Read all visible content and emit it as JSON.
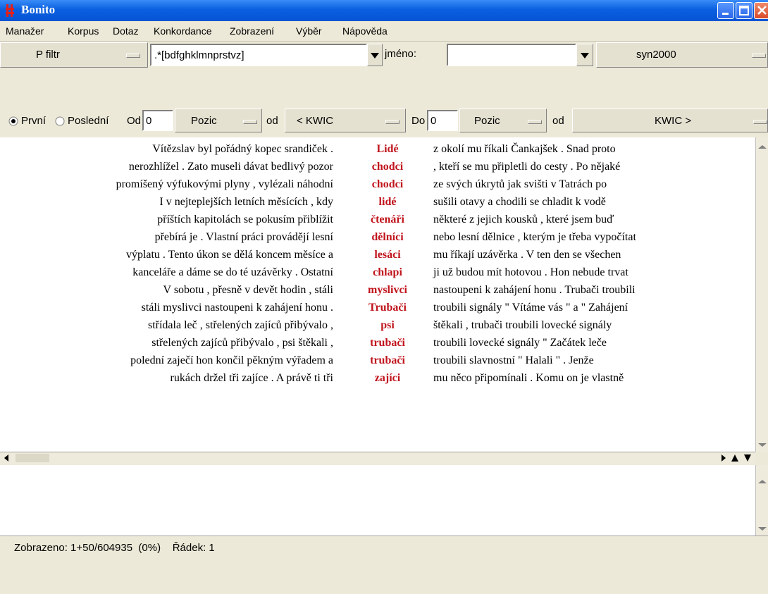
{
  "window": {
    "title": "Bonito"
  },
  "menu": [
    "Manažer",
    "Korpus",
    "Dotaz",
    "Konkordance",
    "Zobrazení",
    "Výběr",
    "Nápověda"
  ],
  "toolbar1": {
    "filter_button": "P filtr",
    "pattern_value": ".*[bdfghklmnprstvz]",
    "name_label": "jméno:",
    "name_value": "",
    "corpus_button": "syn2000"
  },
  "toolbar2": {
    "radio_first": "První",
    "radio_last": "Poslední",
    "radio_selected": "První",
    "od_label": "Od",
    "od_value": "0",
    "pozic1": "Pozic",
    "od2_label": "od",
    "kwic_left": "< KWIC",
    "do_label": "Do",
    "do_value": "0",
    "pozic2": "Pozic",
    "od3_label": "od",
    "kwic_right": "KWIC >"
  },
  "concordance": [
    {
      "left": "Vítězslav byl pořádný kopec srandiček .",
      "kwic": "Lidé",
      "right": "z okolí mu říkali Čankajšek . Snad proto"
    },
    {
      "left": "nerozhlížel . Zato museli dávat bedlivý pozor",
      "kwic": "chodci",
      "right": ", kteří se mu připletli do cesty . Po nějaké"
    },
    {
      "left": "promíšený výfukovými plyny , vylézali náhodní",
      "kwic": "chodci",
      "right": "ze svých úkrytů jak svišti v Tatrách po"
    },
    {
      "left": "I v nejteplejších letních měsících , kdy",
      "kwic": "lidé",
      "right": "sušili otavy a chodili se chladit k vodě"
    },
    {
      "left": "příštích kapitolách se pokusím přiblížit",
      "kwic": "čtenáři",
      "right": "některé z jejich kousků , které jsem buď"
    },
    {
      "left": "přebírá je . Vlastní práci provádějí lesní",
      "kwic": "dělníci",
      "right": "nebo lesní dělnice , kterým je třeba vypočítat"
    },
    {
      "left": "výplatu . Tento úkon se dělá koncem měsíce a",
      "kwic": "lesáci",
      "right": "mu říkají uzávěrka . V ten den se všechen"
    },
    {
      "left": "kanceláře a dáme se do té uzávěrky . Ostatní",
      "kwic": "chlapi",
      "right": "ji už budou mít hotovou . Hon nebude trvat"
    },
    {
      "left": "V sobotu , přesně v devět hodin , stáli",
      "kwic": "myslivci",
      "right": "nastoupeni k zahájení honu . Trubači troubili"
    },
    {
      "left": "stáli myslivci nastoupeni k zahájení honu .",
      "kwic": "Trubači",
      "right": "troubili signály \" Vítáme vás \" a \" Zahájení"
    },
    {
      "left": "střídala leč , střelených zajíců přibývalo ,",
      "kwic": "psi",
      "right": "štěkali , trubači troubili lovecké signály"
    },
    {
      "left": "střelených zajíců přibývalo , psi štěkali ,",
      "kwic": "trubači",
      "right": "troubili lovecké signály \" Začátek leče"
    },
    {
      "left": "polední zaječí hon končil pěkným výřadem a",
      "kwic": "trubači",
      "right": "troubili slavnostní \" Halali \" . Jenže"
    },
    {
      "left": "rukách držel tři zajíce . A právě ti tři",
      "kwic": "zajíci",
      "right": "mu něco připomínali . Komu on je vlastně"
    }
  ],
  "status": {
    "text": "Zobrazeno: 1+50/604935  (0%)    Řádek: 1"
  },
  "colors": {
    "titlebar": "#0a5fe0",
    "keyword": "#c0141c",
    "background": "#ece9d8"
  }
}
